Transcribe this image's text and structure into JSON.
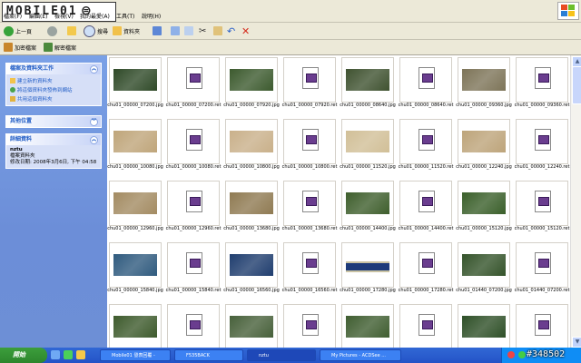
{
  "logo": {
    "text": "MOBILE01"
  },
  "menu": [
    "檔案(F)",
    "編輯(E)",
    "檢視(V)",
    "我的最愛(A)",
    "工具(T)",
    "說明(H)"
  ],
  "toolbar": {
    "back_label": "上一頁",
    "search_label": "搜尋",
    "folders_label": "資料夾"
  },
  "toolbar2": {
    "encrypt_label": "加密檔案",
    "decrypt_label": "解密檔案"
  },
  "sidebar": {
    "tasks_title": "檔案及資料夾工作",
    "tasks": [
      "建立新的資料夾",
      "將這個資料夾發佈到網站",
      "共用這個資料夾"
    ],
    "places_title": "其他位置",
    "details_title": "詳細資料",
    "details_name": "nztu",
    "details_type": "檔案資料夾",
    "details_modified": "修改日期: 2008年3月6日, 下午 04:58"
  },
  "files": [
    {
      "name": "chu01_00000_07200.jpg",
      "kind": "jpg",
      "color": "#2f4a28"
    },
    {
      "name": "chu01_00000_07200.ret",
      "kind": "doc"
    },
    {
      "name": "chu01_00000_07920.jpg",
      "kind": "jpg",
      "color": "#3c5a2e"
    },
    {
      "name": "chu01_00000_07920.ret",
      "kind": "doc"
    },
    {
      "name": "chu01_00000_08640.jpg",
      "kind": "jpg",
      "color": "#3f5230"
    },
    {
      "name": "chu01_00000_08640.ret",
      "kind": "doc"
    },
    {
      "name": "chu01_00000_09360.jpg",
      "kind": "jpg",
      "color": "#7d7458"
    },
    {
      "name": "chu01_00000_09360.ret",
      "kind": "doc"
    },
    {
      "name": "chu01_00000_10080.jpg",
      "kind": "jpg",
      "color": "#bfa57a"
    },
    {
      "name": "chu01_00000_10080.ret",
      "kind": "doc"
    },
    {
      "name": "chu01_00000_10800.jpg",
      "kind": "jpg",
      "color": "#c9b08a"
    },
    {
      "name": "chu01_00000_10800.ret",
      "kind": "doc"
    },
    {
      "name": "chu01_00000_11520.jpg",
      "kind": "jpg",
      "color": "#d1bf97"
    },
    {
      "name": "chu01_00000_11520.ret",
      "kind": "doc"
    },
    {
      "name": "chu01_00000_12240.jpg",
      "kind": "jpg",
      "color": "#bda47a"
    },
    {
      "name": "chu01_00000_12240.ret",
      "kind": "doc"
    },
    {
      "name": "chu01_00000_12960.jpg",
      "kind": "jpg",
      "color": "#a38b62"
    },
    {
      "name": "chu01_00000_12960.ret",
      "kind": "doc"
    },
    {
      "name": "chu01_00000_13680.jpg",
      "kind": "jpg",
      "color": "#8f7a52"
    },
    {
      "name": "chu01_00000_13680.ret",
      "kind": "doc"
    },
    {
      "name": "chu01_00000_14400.jpg",
      "kind": "jpg",
      "color": "#3e5e2c"
    },
    {
      "name": "chu01_00000_14400.ret",
      "kind": "doc"
    },
    {
      "name": "chu01_00000_15120.jpg",
      "kind": "jpg",
      "color": "#3a5f2a"
    },
    {
      "name": "chu01_00000_15120.ret",
      "kind": "doc"
    },
    {
      "name": "chu01_00000_15840.jpg",
      "kind": "jpg",
      "color": "#2f5a7e"
    },
    {
      "name": "chu01_00000_15840.ret",
      "kind": "doc"
    },
    {
      "name": "chu01_00000_16560.jpg",
      "kind": "jpg",
      "color": "#1f3d6e"
    },
    {
      "name": "chu01_00000_16560.ret",
      "kind": "doc"
    },
    {
      "name": "chu01_00000_17280.jpg",
      "kind": "jpg",
      "color": "#1d3a7a",
      "strip": true
    },
    {
      "name": "chu01_00000_17280.ret",
      "kind": "doc"
    },
    {
      "name": "chu01_01440_07200.jpg",
      "kind": "jpg",
      "color": "#34532a"
    },
    {
      "name": "chu01_01440_07200.ret",
      "kind": "doc"
    },
    {
      "name": "",
      "kind": "jpg",
      "color": "#3d5a2c"
    },
    {
      "name": "",
      "kind": "doc"
    },
    {
      "name": "",
      "kind": "jpg",
      "color": "#47603a"
    },
    {
      "name": "",
      "kind": "doc"
    },
    {
      "name": "",
      "kind": "jpg",
      "color": "#3f5d30"
    },
    {
      "name": "",
      "kind": "doc"
    },
    {
      "name": "",
      "kind": "jpg",
      "color": "#2e4f27"
    },
    {
      "name": "",
      "kind": "doc"
    }
  ],
  "taskbar": {
    "start_label": "開始",
    "tasks": [
      "Mobile01 發表回覆 -",
      "F535BACK",
      "nztu",
      "My Pictures - ACDSee ..."
    ],
    "watermark": "#348502"
  },
  "colors": {
    "xp_blue": "#2453c7",
    "start_green": "#3c9e3c",
    "sidebar": "#6d8fd6"
  }
}
